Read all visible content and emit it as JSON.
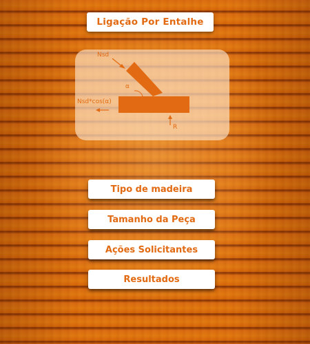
{
  "header": {
    "title": "Ligação Por Entalhe"
  },
  "diagram": {
    "labels": {
      "nsd": "Nsd",
      "alpha": "α",
      "nsd_cos": "Nsd*cos(α)",
      "r": "R"
    },
    "color": "#e26a12"
  },
  "menu": {
    "items": [
      {
        "label": "Tipo de madeira"
      },
      {
        "label": "Tamanho da Peça"
      },
      {
        "label": "Ações Solicitantes"
      },
      {
        "label": "Resultados"
      }
    ]
  },
  "colors": {
    "accent": "#e26a12",
    "button_bg": "#ffffff",
    "wood": "#d96a10"
  }
}
